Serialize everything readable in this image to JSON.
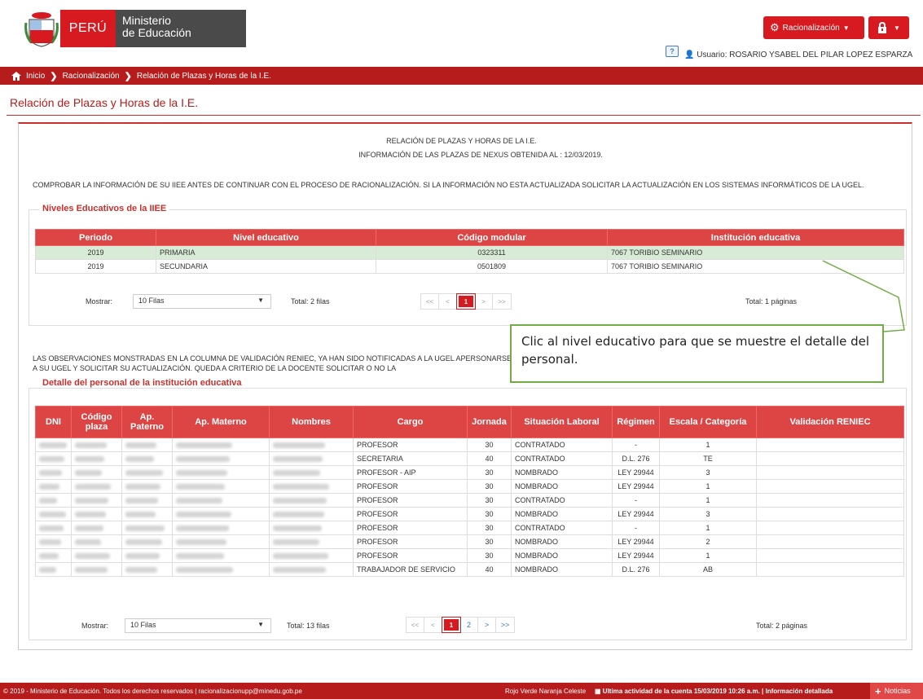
{
  "header": {
    "logo_peru": "PERÚ",
    "logo_ministry_line1": "Ministerio",
    "logo_ministry_line2": "de Educación",
    "racionalizacion_button": "Racionalización",
    "help_icon": "?",
    "user_label": "Usuario: ROSARIO YSABEL DEL PILAR LOPEZ ESPARZA"
  },
  "breadcrumb": [
    "Inicio",
    "Racionalización",
    "Relación de Plazas y Horas de la I.E."
  ],
  "page_title": "Relación de Plazas y Horas de la I.E.",
  "report": {
    "title": "RELACIÓN DE PLAZAS Y HORAS DE LA I.E.",
    "subtitle": "INFORMACIÓN DE LAS PLAZAS DE NEXUS OBTENIDA AL : 12/03/2019.",
    "notice": "COMPROBAR LA INFORMACIÓN DE SU IIEE ANTES DE CONTINUAR CON EL PROCESO DE RACIONALIZACIÓN. SI LA INFORMACIÓN NO ESTA ACTUALIZADA SOLICITAR LA ACTUALIZACIÓN EN LOS SISTEMAS INFORMÁTICOS DE LA UGEL."
  },
  "niveles": {
    "legend": "Niveles Educativos de la IIEE",
    "columns": [
      "Periodo",
      "Nivel educativo",
      "Código modular",
      "Institución educativa"
    ],
    "rows": [
      {
        "periodo": "2019",
        "nivel": "PRIMARIA",
        "codigo": "0323311",
        "institucion": "7067 TORIBIO SEMINARIO"
      },
      {
        "periodo": "2019",
        "nivel": "SECUNDARIA",
        "codigo": "0501809",
        "institucion": "7067 TORIBIO SEMINARIO"
      }
    ],
    "mostrar_label": "Mostrar:",
    "filas_option": "10 Filas",
    "total": "Total: 2 filas",
    "pager": [
      "<<",
      "<",
      "1",
      ">",
      ">>"
    ],
    "total_pages": "Total: 1 páginas"
  },
  "reniec_notice": "LAS OBSERVACIONES MONSTRADAS EN LA COLUMNA DE VALIDACIÓN RENIEC, YA HAN SIDO NOTIFICADAS A LA UGEL APERSONARSE A SU UGEL Y SOLICITAR SU ACTUALIZACIÓN. QUEDA A CRITERIO DE LA DOCENTE SOLICITAR O NO LA",
  "callout": "Clic al nivel educativo para que se muestre el detalle del personal.",
  "personal": {
    "legend": "Detalle del personal de la institución educativa",
    "columns": [
      "DNI",
      "Código plaza",
      "Ap. Paterno",
      "Ap. Materno",
      "Nombres",
      "Cargo",
      "Jornada",
      "Situación Laboral",
      "Régimen",
      "Escala / Categoría",
      "Validación RENIEC"
    ],
    "rows": [
      {
        "cargo": "PROFESOR",
        "jornada": "30",
        "situacion": "CONTRATADO",
        "regimen": "-",
        "escala": "1"
      },
      {
        "cargo": "SECRETARIA",
        "jornada": "40",
        "situacion": "CONTRATADO",
        "regimen": "D.L. 276",
        "escala": "TE"
      },
      {
        "cargo": "PROFESOR - AIP",
        "jornada": "30",
        "situacion": "NOMBRADO",
        "regimen": "LEY 29944",
        "escala": "3"
      },
      {
        "cargo": "PROFESOR",
        "jornada": "30",
        "situacion": "NOMBRADO",
        "regimen": "LEY 29944",
        "escala": "1"
      },
      {
        "cargo": "PROFESOR",
        "jornada": "30",
        "situacion": "CONTRATADO",
        "regimen": "-",
        "escala": "1"
      },
      {
        "cargo": "PROFESOR",
        "jornada": "30",
        "situacion": "NOMBRADO",
        "regimen": "LEY 29944",
        "escala": "3"
      },
      {
        "cargo": "PROFESOR",
        "jornada": "30",
        "situacion": "CONTRATADO",
        "regimen": "-",
        "escala": "1"
      },
      {
        "cargo": "PROFESOR",
        "jornada": "30",
        "situacion": "NOMBRADO",
        "regimen": "LEY 29944",
        "escala": "2"
      },
      {
        "cargo": "PROFESOR",
        "jornada": "30",
        "situacion": "NOMBRADO",
        "regimen": "LEY 29944",
        "escala": "1"
      },
      {
        "cargo": "TRABAJADOR DE SERVICIO",
        "jornada": "40",
        "situacion": "NOMBRADO",
        "regimen": "D.L. 276",
        "escala": "AB"
      }
    ],
    "mostrar_label": "Mostrar:",
    "filas_option": "10 Filas",
    "total": "Total: 13 filas",
    "pager": [
      "<<",
      "<",
      "1",
      "2",
      ">",
      ">>"
    ],
    "total_pages": "Total: 2 páginas"
  },
  "footer": {
    "copyright": "© 2019 - Ministerio de Educación. Todos los derechos reservados  |  racionalizacionupp@minedu.gob.pe",
    "themes": "Rojo  Verde  Naranja  Celeste",
    "last_activity": "Ultima actividad de la cuenta 15/03/2019 10:26 a.m.  |  Información detallada",
    "news": "Noticias"
  },
  "colors": {
    "brand_red": "#d71920",
    "dark_red": "#b71c1c",
    "table_header": "#dd4444",
    "callout_border": "#70ad47"
  }
}
